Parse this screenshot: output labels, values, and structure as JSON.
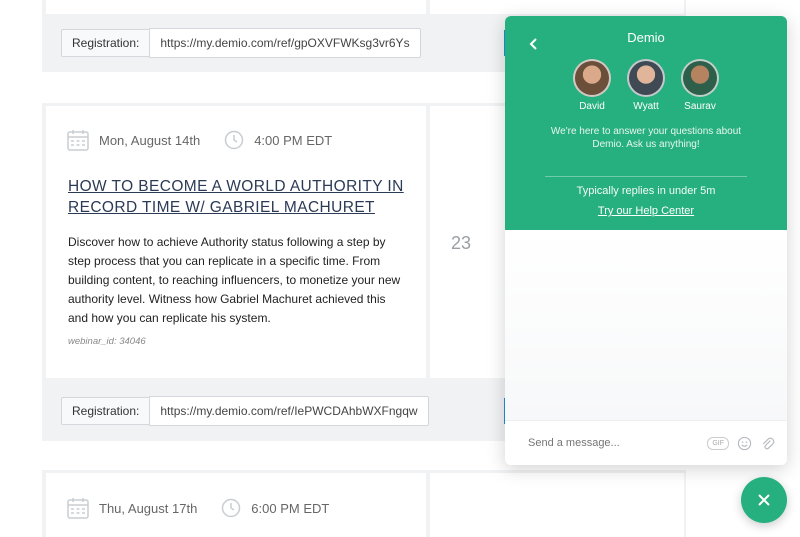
{
  "events": [
    {
      "registration_label": "Registration:",
      "registration_url": "https://my.demio.com/ref/gpOXVFWKsg3vr6Ys"
    },
    {
      "date": "Mon, August 14th",
      "time": "4:00 PM EDT",
      "title": "HOW TO BECOME A WORLD AUTHORITY IN RECORD TIME W/ GABRIEL MACHURET",
      "description": "Discover how to achieve Authority status following a step by step process that you can replicate in a specific time. From building content, to reaching influencers, to monetize your new authority level. Witness how Gabriel Machuret achieved this and how you can replicate his system.",
      "webinar_id": "webinar_id: 34046",
      "count": "23",
      "registration_label": "Registration:",
      "registration_url": "https://my.demio.com/ref/IePWCDAhbWXFngqw"
    },
    {
      "date": "Thu, August 17th",
      "time": "6:00 PM EDT"
    }
  ],
  "chat": {
    "title": "Demio",
    "agents": [
      {
        "name": "David",
        "color": "#6b4f3a"
      },
      {
        "name": "Wyatt",
        "color": "#3f4a55"
      },
      {
        "name": "Saurav",
        "color": "#2e5f4a"
      }
    ],
    "tagline": "We're here to answer your questions about Demio. Ask us anything!",
    "reply_time": "Typically replies in under 5m",
    "help_link": "Try our Help Center",
    "input_placeholder": "Send a message...",
    "gif_label": "GIF",
    "accent_color": "#27b07f"
  },
  "fab": {
    "icon": "close-icon"
  }
}
